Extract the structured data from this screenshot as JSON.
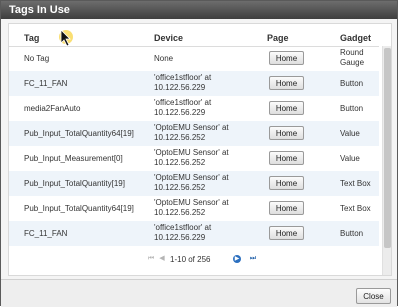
{
  "dialog": {
    "title": "Tags In Use"
  },
  "columns": {
    "tag": "Tag",
    "device": "Device",
    "page": "Page",
    "gadget": "Gadget"
  },
  "rows": [
    {
      "tag": "No Tag",
      "device": [
        "None"
      ],
      "page": "Home",
      "gadget": [
        "Round",
        "Gauge"
      ]
    },
    {
      "tag": "FC_11_FAN",
      "device": [
        "'office1stfloor' at",
        "10.122.56.229"
      ],
      "page": "Home",
      "gadget": [
        "Button"
      ]
    },
    {
      "tag": "media2FanAuto",
      "device": [
        "'office1stfloor' at",
        "10.122.56.229"
      ],
      "page": "Home",
      "gadget": [
        "Button"
      ]
    },
    {
      "tag": "Pub_Input_TotalQuantity64[19]",
      "device": [
        "'OptoEMU Sensor' at",
        "10.122.56.252"
      ],
      "page": "Home",
      "gadget": [
        "Value"
      ]
    },
    {
      "tag": "Pub_Input_Measurement[0]",
      "device": [
        "'OptoEMU Sensor' at",
        "10.122.56.252"
      ],
      "page": "Home",
      "gadget": [
        "Value"
      ]
    },
    {
      "tag": "Pub_Input_TotalQuantity[19]",
      "device": [
        "'OptoEMU Sensor' at",
        "10.122.56.252"
      ],
      "page": "Home",
      "gadget": [
        "Text Box"
      ]
    },
    {
      "tag": "Pub_Input_TotalQuantity64[19]",
      "device": [
        "'OptoEMU Sensor' at",
        "10.122.56.252"
      ],
      "page": "Home",
      "gadget": [
        "Text Box"
      ]
    },
    {
      "tag": "FC_11_FAN",
      "device": [
        "'office1stfloor' at",
        "10.122.56.229"
      ],
      "page": "Home",
      "gadget": [
        "Button"
      ]
    }
  ],
  "pager": {
    "label": "1-10 of 256",
    "first_icon": "first-page-icon",
    "prev_icon": "previous-page-icon",
    "next_icon": "next-page-icon",
    "last_icon": "last-page-icon"
  },
  "footer": {
    "close_label": "Close"
  },
  "colors": {
    "title_bar": "#4a4a4a",
    "alt_row": "#eef4fa",
    "pager_active": "#2b6fbf"
  }
}
